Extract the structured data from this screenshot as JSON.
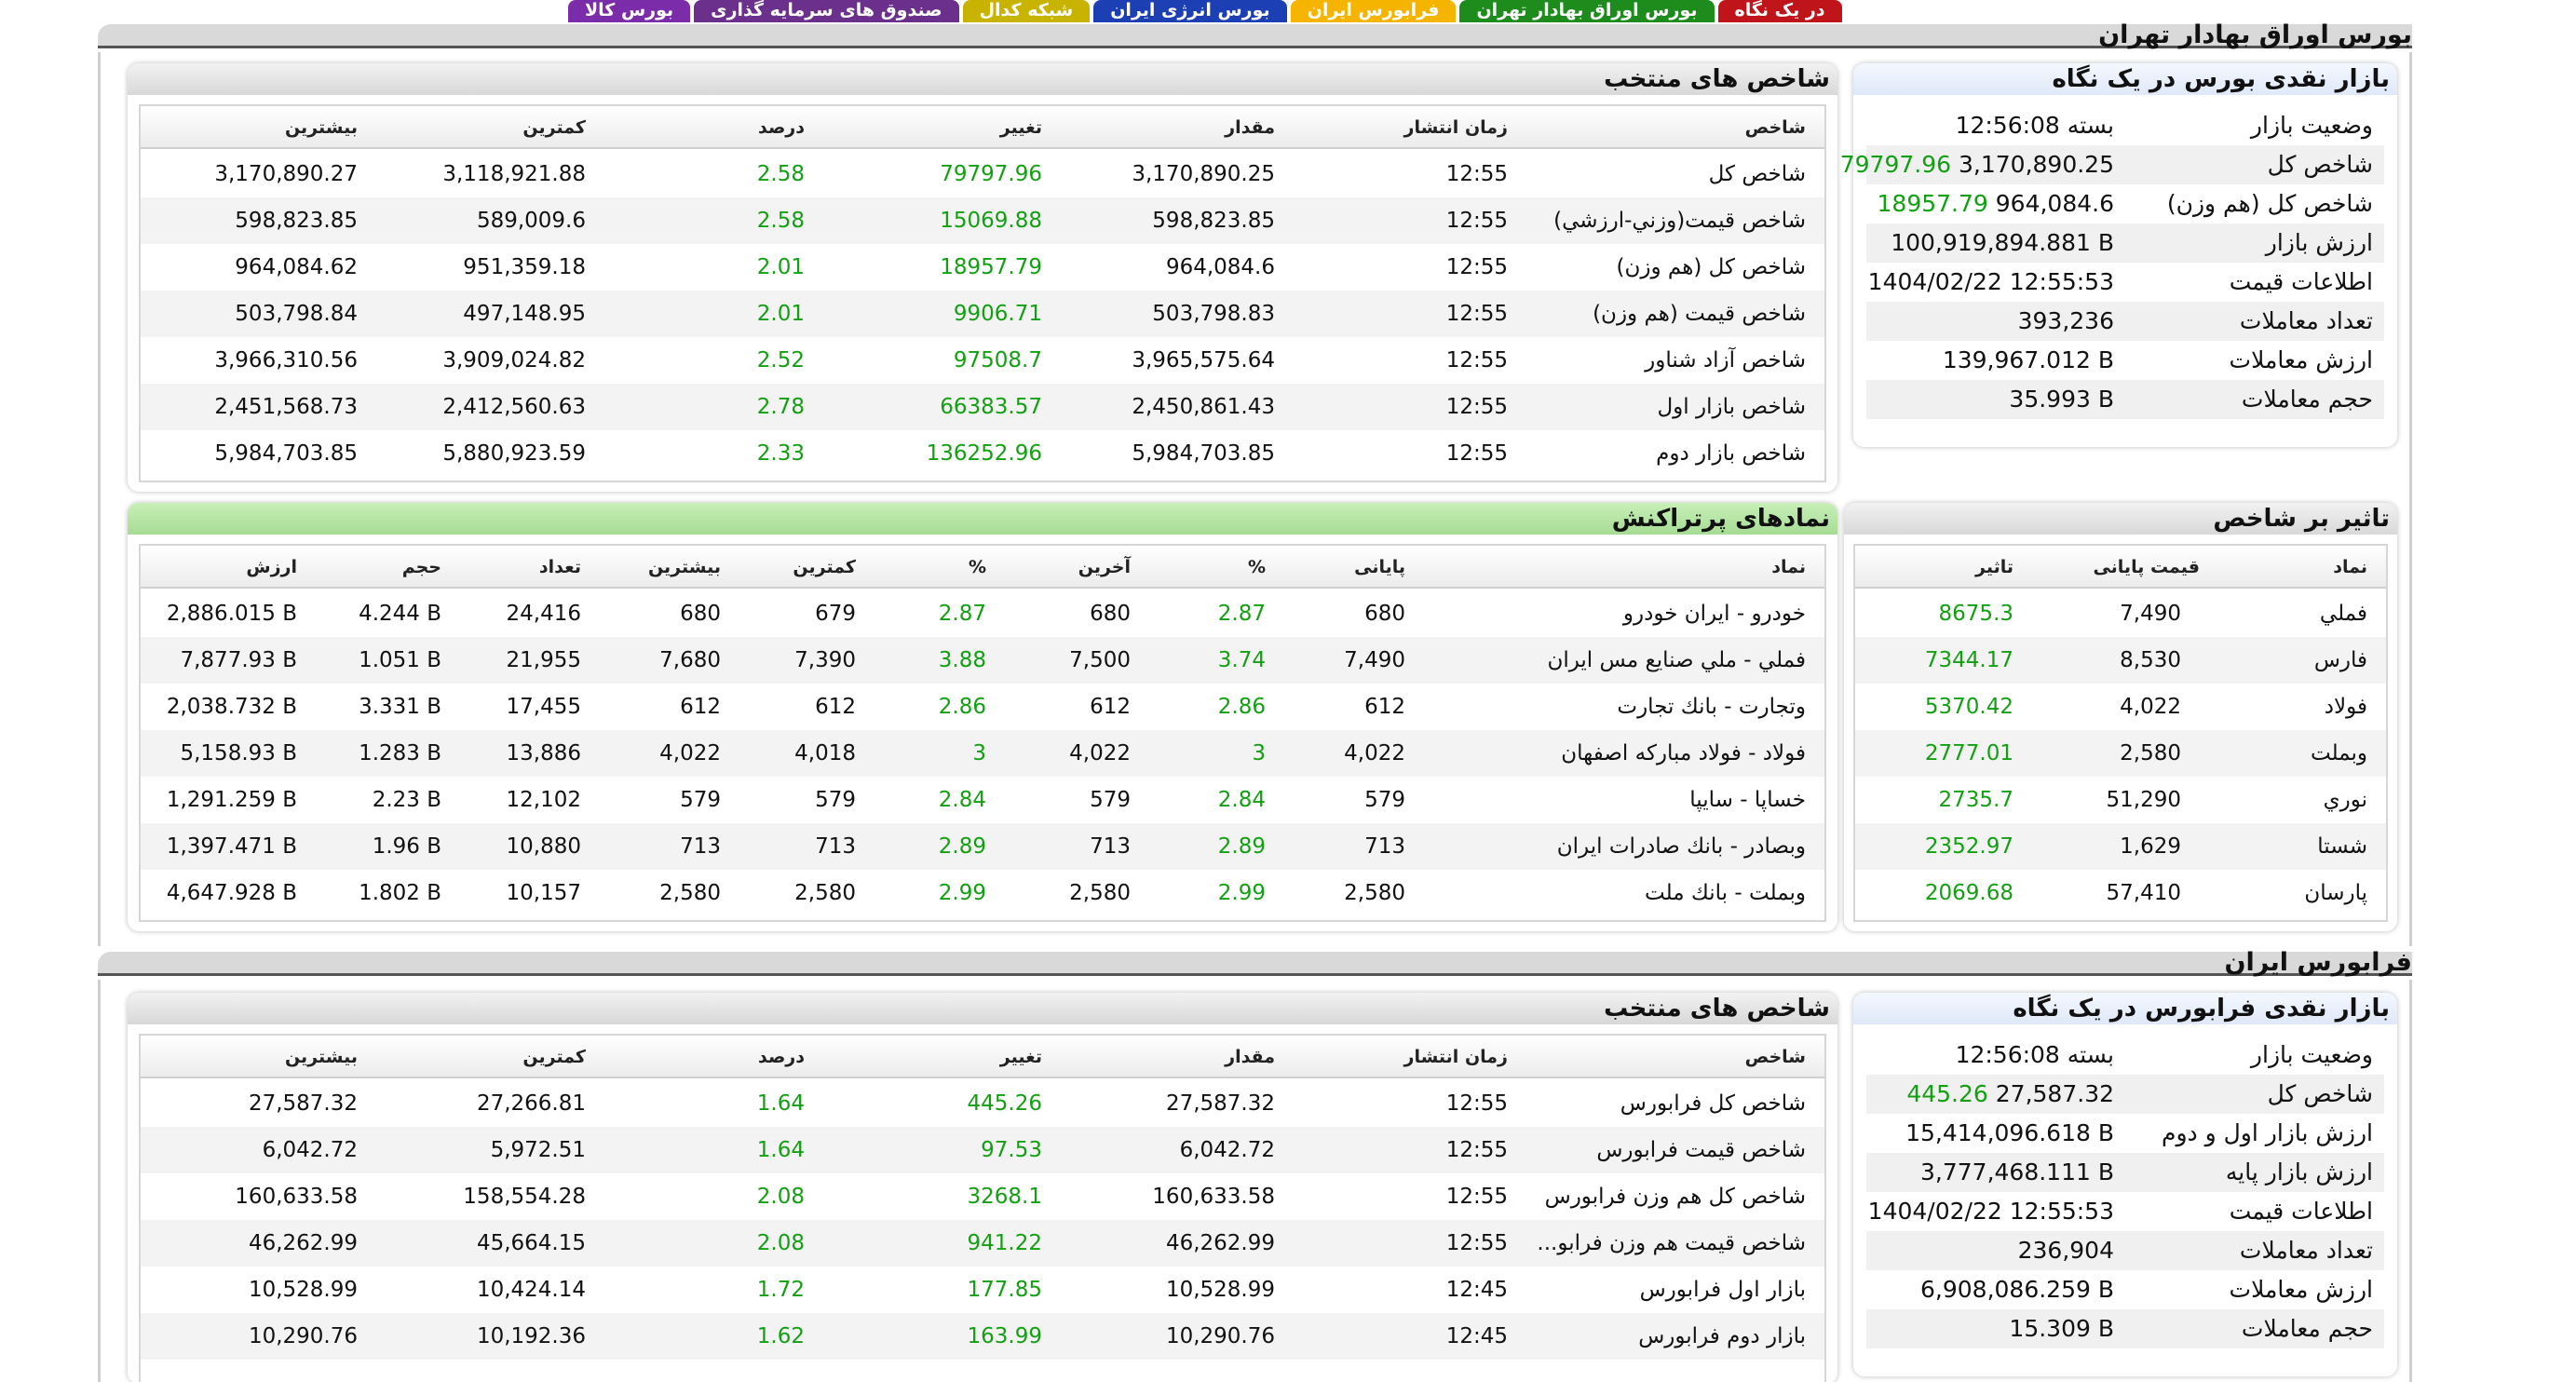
{
  "tabs": [
    {
      "label": "در یک نگاه",
      "color": "#c0141b"
    },
    {
      "label": "بورس اوراق بهادار تهران",
      "color": "#1d8c1d"
    },
    {
      "label": "فرابورس ایران",
      "color": "#f5b400"
    },
    {
      "label": "بورس انرژی ایران",
      "color": "#1d3fb4"
    },
    {
      "label": "شبکه کدال",
      "color": "#c8b400"
    },
    {
      "label": "صندوق های سرمایه گذاری",
      "color": "#6b2f8c"
    },
    {
      "label": "بورس کالا",
      "color": "#7b2ca8"
    }
  ],
  "tse": {
    "title": "بورس اوراق بهادار تهران",
    "overview": {
      "title": "بازار نقدی بورس در یک نگاه",
      "rows": [
        {
          "label": "وضعیت بازار",
          "value": "بسته 12:56:08",
          "extra": ""
        },
        {
          "label": "شاخص کل",
          "value": "3,170,890.25",
          "extra": "79797.96"
        },
        {
          "label": "شاخص کل (هم وزن)",
          "value": "964,084.6",
          "extra": "18957.79"
        },
        {
          "label": "ارزش بازار",
          "value": "100,919,894.881 B",
          "extra": ""
        },
        {
          "label": "اطلاعات قیمت",
          "value": "1404/02/22 12:55:53",
          "extra": ""
        },
        {
          "label": "تعداد معاملات",
          "value": "393,236",
          "extra": ""
        },
        {
          "label": "ارزش معاملات",
          "value": "139,967.012 B",
          "extra": ""
        },
        {
          "label": "حجم معاملات",
          "value": "35.993 B",
          "extra": ""
        }
      ]
    },
    "indices": {
      "title": "شاخص های منتخب",
      "headers": {
        "name": "شاخص",
        "time": "زمان انتشار",
        "value": "مقدار",
        "change": "تغییر",
        "percent": "درصد",
        "min": "کمترین",
        "max": "بیشترین"
      },
      "rows": [
        {
          "name": "شاخص كل",
          "time": "12:55",
          "value": "3,170,890.25",
          "change": "79797.96",
          "percent": "2.58",
          "min": "3,118,921.88",
          "max": "3,170,890.27"
        },
        {
          "name": "شاخص قيمت(وزني-ارزشي)",
          "time": "12:55",
          "value": "598,823.85",
          "change": "15069.88",
          "percent": "2.58",
          "min": "589,009.6",
          "max": "598,823.85"
        },
        {
          "name": "شاخص كل (هم وزن)",
          "time": "12:55",
          "value": "964,084.6",
          "change": "18957.79",
          "percent": "2.01",
          "min": "951,359.18",
          "max": "964,084.62"
        },
        {
          "name": "شاخص قيمت (هم وزن)",
          "time": "12:55",
          "value": "503,798.83",
          "change": "9906.71",
          "percent": "2.01",
          "min": "497,148.95",
          "max": "503,798.84"
        },
        {
          "name": "شاخص آزاد شناور",
          "time": "12:55",
          "value": "3,965,575.64",
          "change": "97508.7",
          "percent": "2.52",
          "min": "3,909,024.82",
          "max": "3,966,310.56"
        },
        {
          "name": "شاخص بازار اول",
          "time": "12:55",
          "value": "2,450,861.43",
          "change": "66383.57",
          "percent": "2.78",
          "min": "2,412,560.63",
          "max": "2,451,568.73"
        },
        {
          "name": "شاخص بازار دوم",
          "time": "12:55",
          "value": "5,984,703.85",
          "change": "136252.96",
          "percent": "2.33",
          "min": "5,880,923.59",
          "max": "5,984,703.85"
        }
      ]
    },
    "impact": {
      "title": "تاثیر بر شاخص",
      "headers": {
        "symbol": "نماد",
        "close": "قیمت پایانی",
        "impact": "تاثیر"
      },
      "rows": [
        {
          "symbol": "فملي",
          "close": "7,490",
          "impact": "8675.3"
        },
        {
          "symbol": "فارس",
          "close": "8,530",
          "impact": "7344.17"
        },
        {
          "symbol": "فولاد",
          "close": "4,022",
          "impact": "5370.42"
        },
        {
          "symbol": "وبملت",
          "close": "2,580",
          "impact": "2777.01"
        },
        {
          "symbol": "نوري",
          "close": "51,290",
          "impact": "2735.7"
        },
        {
          "symbol": "شستا",
          "close": "1,629",
          "impact": "2352.97"
        },
        {
          "symbol": "پارسان",
          "close": "57,410",
          "impact": "2069.68"
        }
      ]
    },
    "active": {
      "title": "نمادهای پرتراکنش",
      "headers": {
        "symbol": "نماد",
        "close": "پایانی",
        "close_pct": "%",
        "last": "آخرین",
        "last_pct": "%",
        "min": "کمترین",
        "max": "بیشترین",
        "count": "تعداد",
        "volume": "حجم",
        "value": "ارزش"
      },
      "rows": [
        {
          "symbol": "خودرو - ايران خودرو",
          "close": "680",
          "close_pct": "2.87",
          "last": "680",
          "last_pct": "2.87",
          "min": "679",
          "max": "680",
          "count": "24,416",
          "volume": "4.244 B",
          "value": "2,886.015 B"
        },
        {
          "symbol": "فملي - ملي صنايع مس ايران",
          "close": "7,490",
          "close_pct": "3.74",
          "last": "7,500",
          "last_pct": "3.88",
          "min": "7,390",
          "max": "7,680",
          "count": "21,955",
          "volume": "1.051 B",
          "value": "7,877.93 B"
        },
        {
          "symbol": "وتجارت - بانك تجارت",
          "close": "612",
          "close_pct": "2.86",
          "last": "612",
          "last_pct": "2.86",
          "min": "612",
          "max": "612",
          "count": "17,455",
          "volume": "3.331 B",
          "value": "2,038.732 B"
        },
        {
          "symbol": "فولاد - فولاد مباركه اصفهان",
          "close": "4,022",
          "close_pct": "3",
          "last": "4,022",
          "last_pct": "3",
          "min": "4,018",
          "max": "4,022",
          "count": "13,886",
          "volume": "1.283 B",
          "value": "5,158.93 B"
        },
        {
          "symbol": "خساپا - سايپا",
          "close": "579",
          "close_pct": "2.84",
          "last": "579",
          "last_pct": "2.84",
          "min": "579",
          "max": "579",
          "count": "12,102",
          "volume": "2.23 B",
          "value": "1,291.259 B"
        },
        {
          "symbol": "وبصادر - بانك صادرات ايران",
          "close": "713",
          "close_pct": "2.89",
          "last": "713",
          "last_pct": "2.89",
          "min": "713",
          "max": "713",
          "count": "10,880",
          "volume": "1.96 B",
          "value": "1,397.471 B"
        },
        {
          "symbol": "وبملت - بانك ملت",
          "close": "2,580",
          "close_pct": "2.99",
          "last": "2,580",
          "last_pct": "2.99",
          "min": "2,580",
          "max": "2,580",
          "count": "10,157",
          "volume": "1.802 B",
          "value": "4,647.928 B"
        }
      ]
    }
  },
  "ifb": {
    "title": "فرابورس ایران",
    "overview": {
      "title": "بازار نقدی فرابورس در یک نگاه",
      "rows": [
        {
          "label": "وضعیت بازار",
          "value": "بسته 12:56:08",
          "extra": ""
        },
        {
          "label": "شاخص کل",
          "value": "27,587.32",
          "extra": "445.26"
        },
        {
          "label": "ارزش بازار اول و دوم",
          "value": "15,414,096.618 B",
          "extra": ""
        },
        {
          "label": "ارزش بازار پایه",
          "value": "3,777,468.111 B",
          "extra": ""
        },
        {
          "label": "اطلاعات قیمت",
          "value": "1404/02/22 12:55:53",
          "extra": ""
        },
        {
          "label": "تعداد معاملات",
          "value": "236,904",
          "extra": ""
        },
        {
          "label": "ارزش معاملات",
          "value": "6,908,086.259 B",
          "extra": ""
        },
        {
          "label": "حجم معاملات",
          "value": "15.309 B",
          "extra": ""
        }
      ]
    },
    "indices": {
      "title": "شاخص های منتخب",
      "headers": {
        "name": "شاخص",
        "time": "زمان انتشار",
        "value": "مقدار",
        "change": "تغییر",
        "percent": "درصد",
        "min": "کمترین",
        "max": "بیشترین"
      },
      "rows": [
        {
          "name": "شاخص كل فرابورس",
          "time": "12:55",
          "value": "27,587.32",
          "change": "445.26",
          "percent": "1.64",
          "min": "27,266.81",
          "max": "27,587.32"
        },
        {
          "name": "شاخص قيمت فرابورس",
          "time": "12:55",
          "value": "6,042.72",
          "change": "97.53",
          "percent": "1.64",
          "min": "5,972.51",
          "max": "6,042.72"
        },
        {
          "name": "شاخص كل هم وزن فرابورس",
          "time": "12:55",
          "value": "160,633.58",
          "change": "3268.1",
          "percent": "2.08",
          "min": "158,554.28",
          "max": "160,633.58"
        },
        {
          "name": "شاخص قيمت هم وزن فرابو...",
          "time": "12:55",
          "value": "46,262.99",
          "change": "941.22",
          "percent": "2.08",
          "min": "45,664.15",
          "max": "46,262.99"
        },
        {
          "name": "بازار اول فرابورس",
          "time": "12:45",
          "value": "10,528.99",
          "change": "177.85",
          "percent": "1.72",
          "min": "10,424.14",
          "max": "10,528.99"
        },
        {
          "name": "بازار دوم فرابورس",
          "time": "12:45",
          "value": "10,290.76",
          "change": "163.99",
          "percent": "1.62",
          "min": "10,192.36",
          "max": "10,290.76"
        }
      ]
    }
  }
}
